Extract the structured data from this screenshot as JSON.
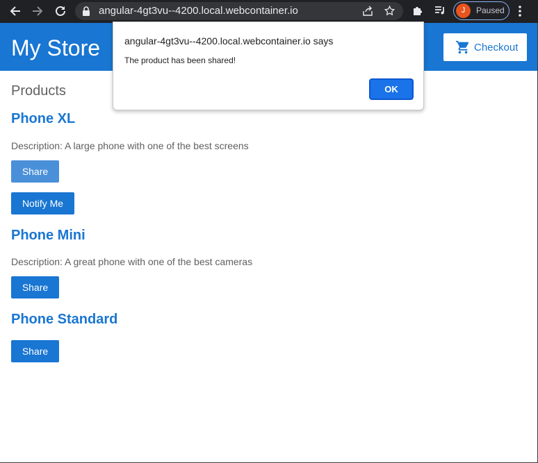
{
  "browser": {
    "url": "angular-4gt3vu--4200.local.webcontainer.io",
    "profile_initial": "J",
    "profile_status": "Paused",
    "icons": [
      "back-icon",
      "forward-icon",
      "reload-icon",
      "lock-icon",
      "share-icon",
      "star-icon",
      "extensions-icon",
      "media-icon",
      "more-icon"
    ]
  },
  "header": {
    "title": "My Store",
    "checkout_label": "Checkout",
    "accent": "#1976d2"
  },
  "main": {
    "heading": "Products",
    "products": [
      {
        "name": "Phone XL",
        "description": "Description: A large phone with one of the best screens",
        "share_label": "Share",
        "notify_label": "Notify Me"
      },
      {
        "name": "Phone Mini",
        "description": "Description: A great phone with one of the best cameras",
        "share_label": "Share"
      },
      {
        "name": "Phone Standard",
        "share_label": "Share"
      }
    ]
  },
  "dialog": {
    "origin": "angular-4gt3vu--4200.local.webcontainer.io says",
    "message": "The product has been shared!",
    "ok_label": "OK"
  }
}
